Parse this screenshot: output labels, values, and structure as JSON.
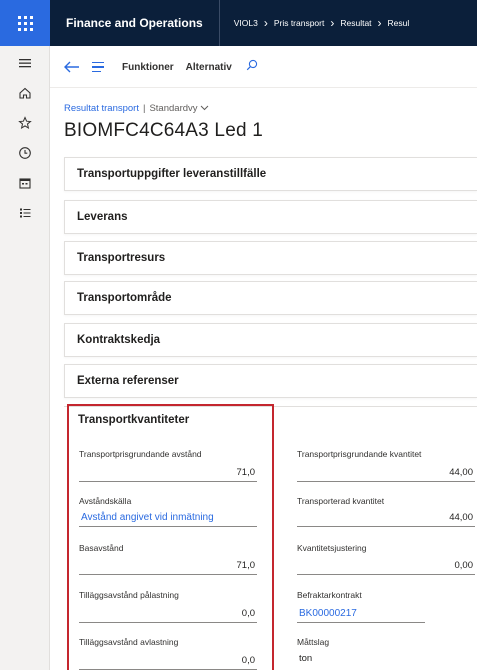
{
  "topbar": {
    "app_title": "Finance and Operations",
    "breadcrumbs": [
      "VIOL3",
      "Pris transport",
      "Resultat",
      "Resul"
    ]
  },
  "leftnav": {
    "icons": [
      "hamburger-icon",
      "home-icon",
      "star-icon",
      "clock-icon",
      "calendar-icon",
      "list-icon"
    ]
  },
  "actionbar": {
    "functions_label": "Funktioner",
    "alternatives_label": "Alternativ"
  },
  "header": {
    "entity_link": "Resultat transport",
    "separator": "|",
    "view_label": "Standardvy",
    "record_title": "BIOMFC4C64A3 Led 1"
  },
  "fasttabs": [
    "Transportuppgifter leveranstillfälle",
    "Leverans",
    "Transportresurs",
    "Transportområde",
    "Kontraktskedja",
    "Externa referenser"
  ],
  "section": {
    "title": "Transportkvantiteter",
    "left_fields": [
      {
        "label": "Transportprisgrundande avstånd",
        "value": "71,0"
      },
      {
        "label": "Avståndskälla",
        "value": "Avstånd angivet vid inmätning"
      },
      {
        "label": "Basavstånd",
        "value": "71,0"
      },
      {
        "label": "Tilläggsavstånd pålastning",
        "value": "0,0"
      },
      {
        "label": "Tilläggsavstånd avlastning",
        "value": "0,0"
      }
    ],
    "right_fields": [
      {
        "label": "Transportprisgrundande kvantitet",
        "value": "44,00"
      },
      {
        "label": "Transporterad kvantitet",
        "value": "44,00"
      },
      {
        "label": "Kvantitetsjustering",
        "value": "0,00"
      },
      {
        "label": "Befraktarkontrakt",
        "value": "BK00000217"
      },
      {
        "label": "Måttslag",
        "value": "ton"
      }
    ]
  },
  "colors": {
    "topbar": "#0b1f3a",
    "accent": "#2a6ae0",
    "highlight": "#c4262e"
  }
}
